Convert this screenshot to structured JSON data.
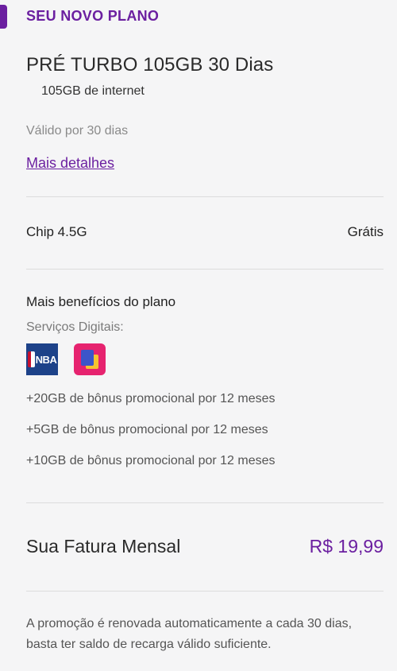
{
  "header": {
    "title": "SEU NOVO PLANO"
  },
  "plan": {
    "name": "PRÉ TURBO 105GB 30 Dias",
    "data": "105GB de internet",
    "validity": "Válido por 30 dias",
    "details_link": "Mais detalhes"
  },
  "chip": {
    "label": "Chip 4.5G",
    "price": "Grátis"
  },
  "benefits": {
    "title": "Mais benefícios do plano",
    "services_label": "Serviços Digitais:",
    "services": [
      {
        "icon": "nba-icon",
        "text": "NBA"
      },
      {
        "icon": "app-icon"
      }
    ],
    "bonuses": [
      "+20GB de bônus promocional por 12 meses",
      "+5GB de bônus promocional por 12 meses",
      "+10GB de bônus promocional por 12 meses"
    ]
  },
  "total": {
    "label": "Sua Fatura Mensal",
    "value": "R$ 19,99"
  },
  "footnote": "A promoção é renovada automaticamente a cada 30 dias, basta ter saldo de recarga válido suficiente.",
  "colors": {
    "accent": "#6b1fa0",
    "background": "#f5f5f6",
    "divider": "#dcdcdc"
  }
}
